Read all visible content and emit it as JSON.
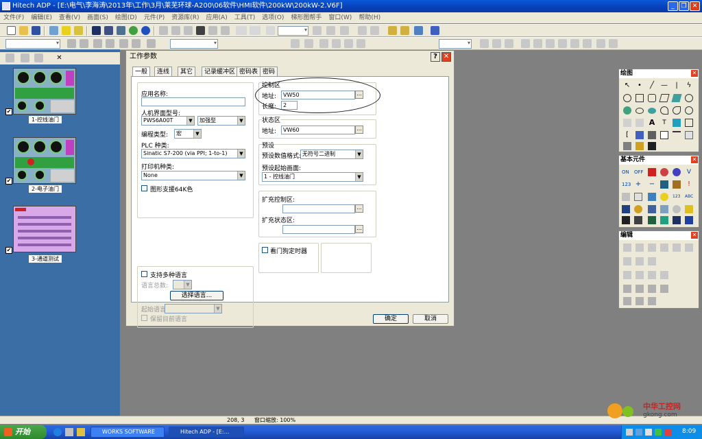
{
  "window": {
    "title": "Hitech ADP - [E:\\电气\\李海涛\\2013年\\工作\\3月\\莱芜环球-A200\\06软件\\HMI软件\\200kW\\200kW-2.V6F]"
  },
  "menubar": {
    "items": [
      "文件(F)",
      "编辑(E)",
      "查看(V)",
      "画面(S)",
      "绘图(D)",
      "元件(P)",
      "资源库(R)",
      "应用(A)",
      "工具(T)",
      "选项(O)",
      "梯形图帮手",
      "窗口(W)",
      "帮助(H)"
    ]
  },
  "screens": [
    {
      "label": "1-控线油门",
      "checked": "✔"
    },
    {
      "label": "2-电子油门",
      "checked": "✔"
    },
    {
      "label": "3-通道测试",
      "checked": "✔"
    }
  ],
  "dialog": {
    "title": "工作参数",
    "help": "?",
    "close": "✕",
    "tabs": [
      "一般",
      "连线",
      "其它",
      "记录缓冲区",
      "密码表",
      "密码"
    ],
    "app_name_label": "应用名称:",
    "app_name_value": "",
    "hmi_model_label": "人机界面型号:",
    "hmi_model_value": "PWS6A00T",
    "hmi_variant_value": "加强型",
    "edit_type_label": "编程类型:",
    "edit_type_value": "宏",
    "plc_label": "PLC 种类:",
    "plc_value": "Sinatic S7-200 (via PPI; 1-to-1)",
    "printer_label": "打印机种类:",
    "printer_value": "None",
    "graphics_64k_label": "图形支援64K色",
    "multilang_label": "支持多种语言",
    "lang_count_label": "语言总数:",
    "select_lang_button": "选择语言...",
    "start_lang_label": "起始语言:",
    "keep_lang_label": "保留目前语言",
    "control_area_label": "控制区",
    "control_address_label": "地址:",
    "control_address_value": "VW50",
    "control_length_label": "长度:",
    "control_length_value": "2",
    "status_area_label": "状态区",
    "status_address_label": "地址:",
    "status_address_value": "VW60",
    "preset_label": "预设",
    "preset_format_label": "预设数值格式:",
    "preset_format_value": "无符号二进制",
    "preset_screen_label": "预设起始画面:",
    "preset_screen_value": "1 - 控线油门",
    "ext_control_label": "扩充控制区:",
    "ext_status_label": "扩充状态区:",
    "watchdog_label": "看门狗定时器",
    "browse": "...",
    "ok_button": "确定",
    "cancel_button": "取消"
  },
  "palettes": {
    "draw_title": "绘图",
    "basic_title": "基本元件",
    "edit_title": "编辑",
    "close": "✕"
  },
  "statusbar": {
    "coords": "208, 3",
    "zoom": "窗口缩放: 100%"
  },
  "taskbar": {
    "start": "开始",
    "tasks": [
      "WORKS SOFTWARE",
      "Hitech ADP - [E:..."
    ],
    "clock": "8:09"
  },
  "watermark": {
    "site": "中华工控网",
    "url": "gkong.com"
  }
}
